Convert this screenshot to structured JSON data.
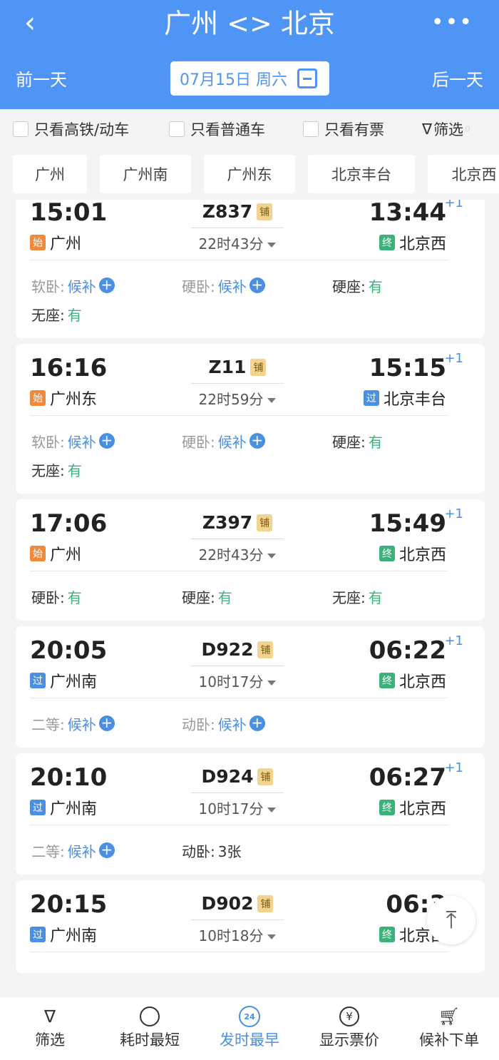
{
  "header": {
    "title": "广州 <> 北京",
    "prev_day": "前一天",
    "next_day": "后一天",
    "date": "07月15日 周六",
    "color": "#4f95f5"
  },
  "filters": {
    "high_speed": "只看高铁/动车",
    "normal": "只看普通车",
    "has_ticket": "只看有票",
    "filter": "筛选",
    "filter_count": "0"
  },
  "stations": [
    "广州",
    "广州南",
    "广州东",
    "北京丰台",
    "北京西"
  ],
  "trains": [
    {
      "dep": "15:01",
      "arr": "13:44",
      "plus": "+1",
      "code": "Z837",
      "pu": "铺",
      "dur": "22时43分",
      "from_tag": "始",
      "from": "广州",
      "to_tag": "终",
      "to": "北京西",
      "seats": [
        {
          "k": "软卧:",
          "v": "候补",
          "s": "wait"
        },
        {
          "k": "硬卧:",
          "v": "候补",
          "s": "wait"
        },
        {
          "k": "硬座:",
          "v": "有",
          "s": "ok"
        },
        {
          "k": "无座:",
          "v": "有",
          "s": "ok"
        }
      ]
    },
    {
      "dep": "16:16",
      "arr": "15:15",
      "plus": "+1",
      "code": "Z11",
      "pu": "铺",
      "dur": "22时59分",
      "from_tag": "始",
      "from": "广州东",
      "to_tag": "过",
      "to": "北京丰台",
      "seats": [
        {
          "k": "软卧:",
          "v": "候补",
          "s": "wait"
        },
        {
          "k": "硬卧:",
          "v": "候补",
          "s": "wait"
        },
        {
          "k": "硬座:",
          "v": "有",
          "s": "ok"
        },
        {
          "k": "无座:",
          "v": "有",
          "s": "ok"
        }
      ]
    },
    {
      "dep": "17:06",
      "arr": "15:49",
      "plus": "+1",
      "code": "Z397",
      "pu": "铺",
      "dur": "22时43分",
      "from_tag": "始",
      "from": "广州",
      "to_tag": "终",
      "to": "北京西",
      "seats": [
        {
          "k": "硬卧:",
          "v": "有",
          "s": "ok"
        },
        {
          "k": "硬座:",
          "v": "有",
          "s": "ok"
        },
        {
          "k": "无座:",
          "v": "有",
          "s": "ok"
        }
      ]
    },
    {
      "dep": "20:05",
      "arr": "06:22",
      "plus": "+1",
      "code": "D922",
      "pu": "铺",
      "dur": "10时17分",
      "from_tag": "过",
      "from": "广州南",
      "to_tag": "终",
      "to": "北京西",
      "seats": [
        {
          "k": "二等:",
          "v": "候补",
          "s": "wait"
        },
        {
          "k": "动卧:",
          "v": "候补",
          "s": "wait"
        }
      ]
    },
    {
      "dep": "20:10",
      "arr": "06:27",
      "plus": "+1",
      "code": "D924",
      "pu": "铺",
      "dur": "10时17分",
      "from_tag": "过",
      "from": "广州南",
      "to_tag": "终",
      "to": "北京西",
      "seats": [
        {
          "k": "二等:",
          "v": "候补",
          "s": "wait"
        },
        {
          "k": "动卧:",
          "v": "3张",
          "s": "num"
        }
      ]
    },
    {
      "dep": "20:15",
      "arr": "06:3",
      "plus": "",
      "code": "D902",
      "pu": "铺",
      "dur": "10时18分",
      "from_tag": "过",
      "from": "广州南",
      "to_tag": "终",
      "to": "北京西",
      "seats": []
    }
  ],
  "tag_colors": {
    "始": "#f08a3a",
    "终": "#3bb27a",
    "过": "#4a8fe0"
  },
  "bottom": [
    {
      "label": "筛选",
      "icon": "filter-icon"
    },
    {
      "label": "耗时最短",
      "icon": "timer-icon"
    },
    {
      "label": "发时最早",
      "icon": "clock-24-icon",
      "active": true,
      "badge": "24"
    },
    {
      "label": "显示票价",
      "icon": "yen-icon",
      "glyph": "¥"
    },
    {
      "label": "候补下单",
      "icon": "cart-plus-icon"
    }
  ]
}
